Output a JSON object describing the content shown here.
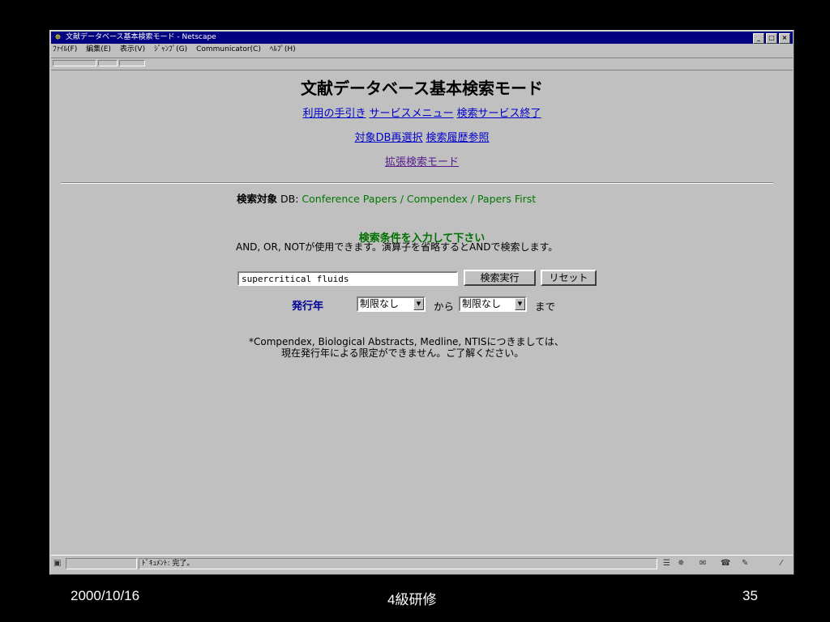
{
  "window": {
    "title": "文献データベース基本検索モード - Netscape",
    "title_icon": "netscape-icon",
    "controls": [
      "_",
      "□",
      "×"
    ]
  },
  "menu": [
    "ﾌｧｲﾙ(F)",
    "編集(E)",
    "表示(V)",
    "ｼﾞｬﾝﾌﾟ(G)",
    "Communicator(C)",
    "ﾍﾙﾌﾟ(H)"
  ],
  "page": {
    "title": "文献データベース基本検索モード",
    "links_row1": [
      "利用の手引き",
      "サービスメニュー",
      "検索サービス終了"
    ],
    "links_row2": [
      "対象DB再選択",
      "検索履歴参照"
    ],
    "link_extended": "拡張検索モード",
    "target_label": "検索対象",
    "target_db_label": "DB:",
    "target_value": "Conference Papers / Compendex / Papers First",
    "instruction": "検索条件を入力して下さい",
    "instruction_note": "AND, OR, NOTが使用できます。演算子を省略するとANDで検索します。",
    "search_value": "supercritical fluids",
    "search_button": "検索実行",
    "reset_button": "リセット",
    "year_label": "発行年",
    "year_from": "制限なし",
    "from_word": "から",
    "year_to": "制限なし",
    "to_word": "まで",
    "note_line1": "*Compendex, Biological Abstracts, Medline, NTISにつきましては、",
    "note_line2": "現在発行年による限定ができません。ご了解ください。"
  },
  "status": {
    "text": "ﾄﾞｷｭﾒﾝﾄ: 完了。"
  },
  "footer": {
    "date": "2000/10/16",
    "center": "4級研修",
    "page": "35"
  },
  "colors": {
    "titlebar": "#000080",
    "link": "#0000cc",
    "visited_link": "#551a8b",
    "green_text": "#007700",
    "year_label": "#000099"
  }
}
